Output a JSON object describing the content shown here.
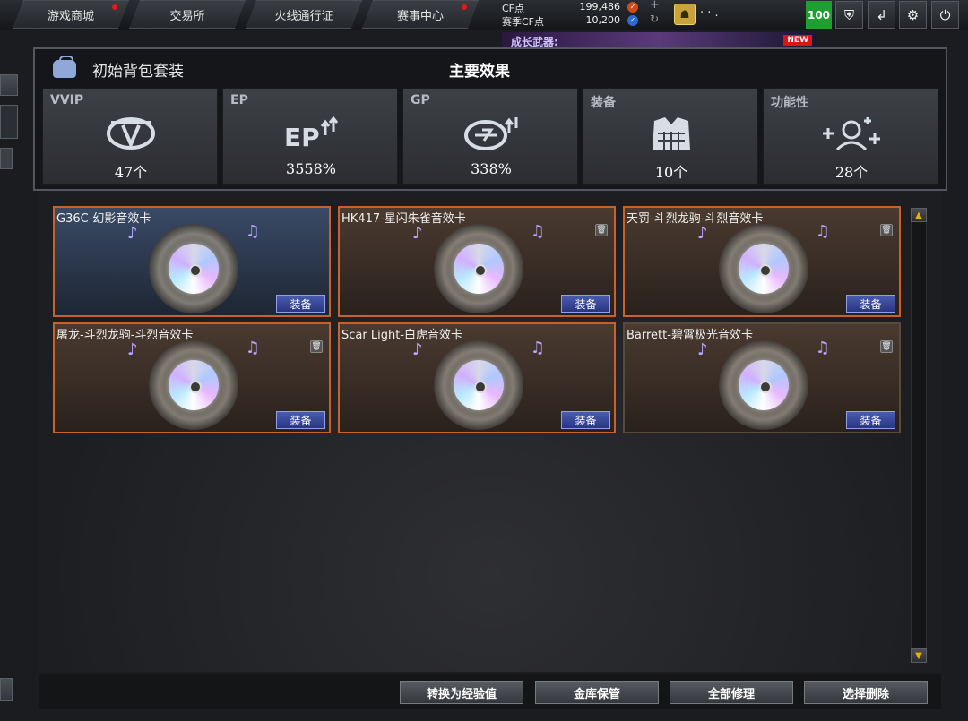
{
  "topnav": {
    "tabs": [
      {
        "label": "游戏商城",
        "dot": true
      },
      {
        "label": "交易所",
        "dot": false
      },
      {
        "label": "火线通行证",
        "dot": false
      },
      {
        "label": "赛事中心",
        "dot": true
      }
    ]
  },
  "currency": {
    "cf_label": "CF点",
    "cf_value": "199,486",
    "season_label": "赛季CF点",
    "season_value": "10,200"
  },
  "user": {
    "nickname": "· · .",
    "level": "100"
  },
  "promo": {
    "text": "成长武器:",
    "new_badge": "NEW"
  },
  "overlay": {
    "package_name": "初始背包套装",
    "title": "主要效果",
    "effects": [
      {
        "label": "VVIP",
        "value": "47个",
        "icon": "vvip-icon"
      },
      {
        "label": "EP",
        "value": "3558%",
        "icon": "ep-up-icon"
      },
      {
        "label": "GP",
        "value": "338%",
        "icon": "gp-up-icon"
      },
      {
        "label": "装备",
        "value": "10个",
        "icon": "armor-icon"
      },
      {
        "label": "功能性",
        "value": "28个",
        "icon": "users-plus-icon"
      }
    ]
  },
  "items": [
    {
      "title": "G36C-幻影音效卡",
      "equip": "装备",
      "style": "blue",
      "trash": false
    },
    {
      "title": "HK417-星闪朱雀音效卡",
      "equip": "装备",
      "style": "brown",
      "trash": true
    },
    {
      "title": "天罚-斗烈龙驹-斗烈音效卡",
      "equip": "装备",
      "style": "brown",
      "trash": true
    },
    {
      "title": "屠龙-斗烈龙驹-斗烈音效卡",
      "equip": "装备",
      "style": "brown",
      "trash": true
    },
    {
      "title": "Scar Light-白虎音效卡",
      "equip": "装备",
      "style": "brown",
      "trash": false
    },
    {
      "title": "Barrett-碧霄极光音效卡",
      "equip": "装备",
      "style": "plain",
      "trash": true
    }
  ],
  "actions": {
    "convert": "转换为经验值",
    "vault": "金库保管",
    "repair_all": "全部修理",
    "delete_selected": "选择删除"
  },
  "colors": {
    "accent_orange": "#c8612a",
    "level_green": "#1f9f31",
    "equip_blue": "#283680"
  }
}
